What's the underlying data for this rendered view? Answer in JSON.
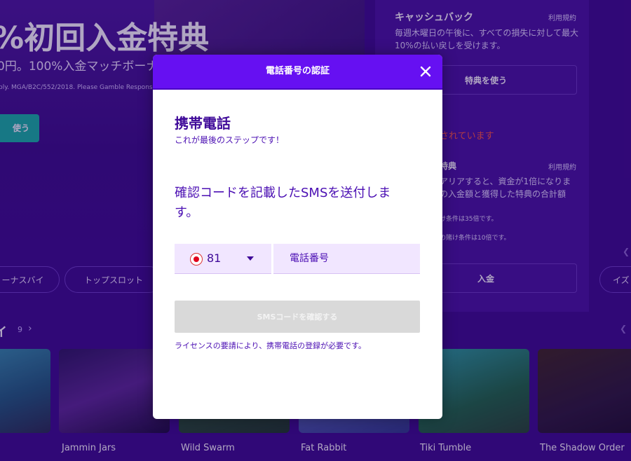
{
  "hero": {
    "title": "%初回入金特典",
    "subtitle": "0円。100%入金マッチボーナ",
    "small": "ply. MGA/B2C/552/2018. Please Gamble Responsibl",
    "button_label": "使う"
  },
  "right_panel": {
    "cashback_title": "キャッシュバック",
    "terms_label": "利用規約",
    "cashback_desc": "毎週木曜日の午後に、すべての損失に対して最大10%の払い戻しを受けます。",
    "use_bonus_label": "特典を使う",
    "warning": "されています",
    "bonus_title": "特典",
    "bonus_terms_label": "利用規約",
    "line1": "アリアすると、資金が1倍になりま",
    "line2": "の入金額と獲得した特典の合計額",
    "line3": "け条件は35倍です。",
    "line4": "の賭け条件は10倍です。",
    "deposit_label": "入金"
  },
  "chips": [
    "ーナスバイ",
    "トップスロット",
    "イズ"
  ],
  "section": {
    "title": "イ",
    "count": "9"
  },
  "games": [
    {
      "name": ""
    },
    {
      "name": "Jammin Jars"
    },
    {
      "name": "Wild Swarm"
    },
    {
      "name": "Fat Rabbit"
    },
    {
      "name": "Tiki Tumble"
    },
    {
      "name": "The Shadow Order"
    }
  ],
  "modal": {
    "title": "電話番号の認証",
    "heading": "携帯電話",
    "subheading": "これが最後のステップです！",
    "send_text": "確認コードを記載したSMSを送付します。",
    "country_code": "81",
    "phone_placeholder": "電話番号",
    "verify_label": "SMSコードを確認する",
    "license_note": "ライセンスの要請により、携帯電話の登録が必要です。"
  },
  "colors": {
    "header": "#6610f2",
    "background": "#3b0d8c",
    "accent_text": "#4b0fb3",
    "disabled_button": "#d9d9d9"
  }
}
